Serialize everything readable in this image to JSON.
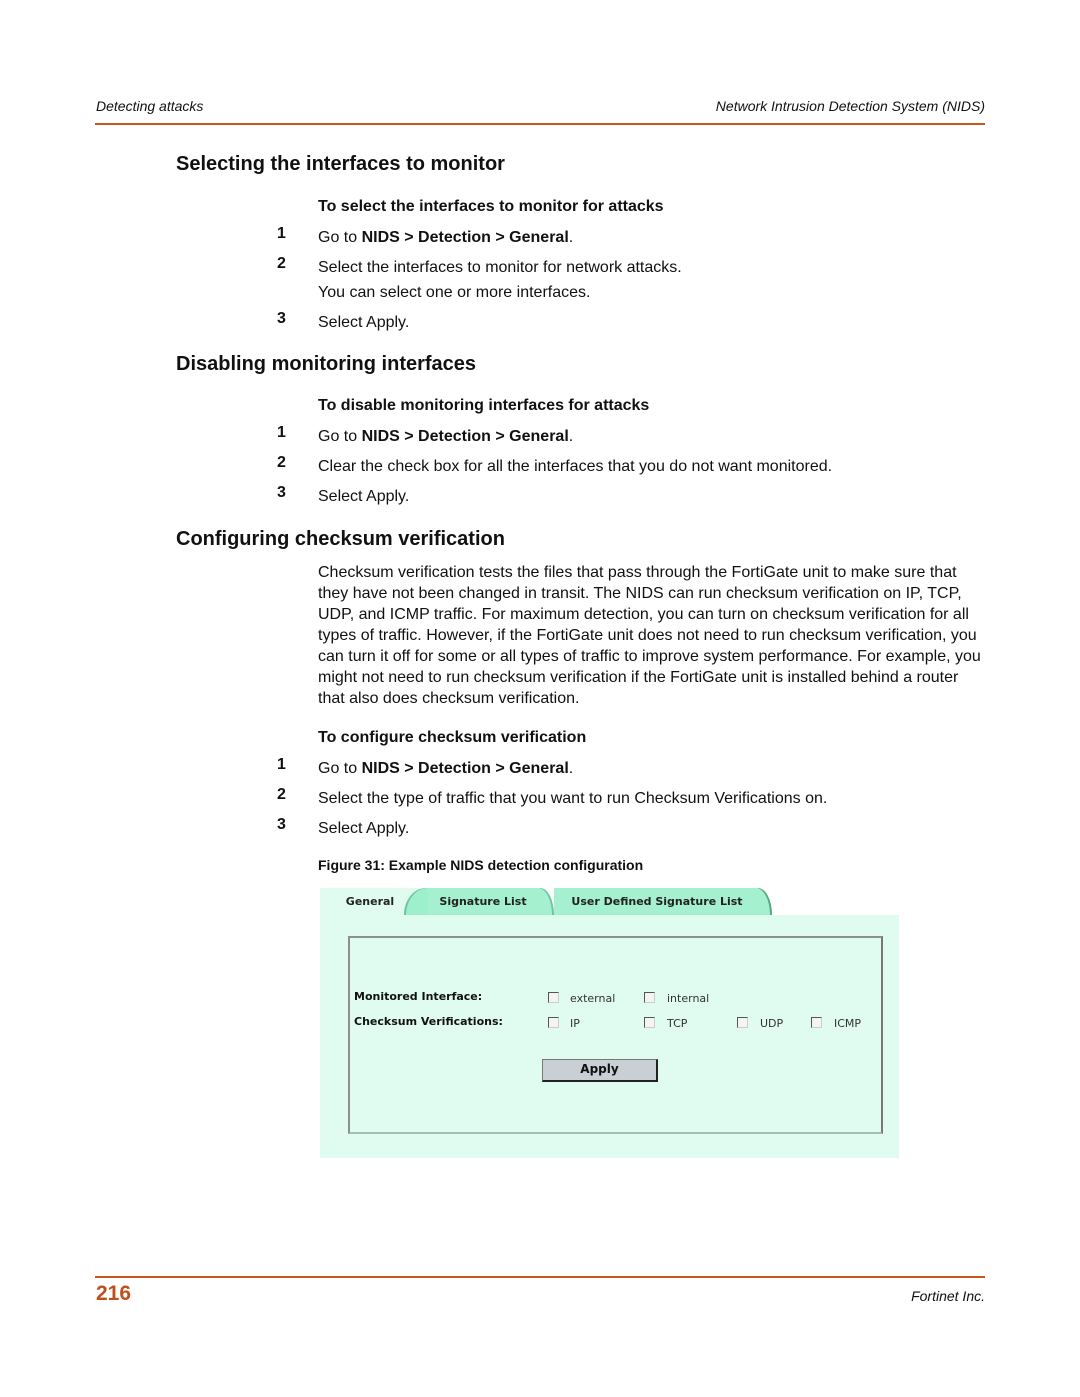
{
  "header": {
    "left": "Detecting attacks",
    "right": "Network Intrusion Detection System (NIDS)"
  },
  "sections": [
    {
      "title": "Selecting the interfaces to monitor",
      "procedure_title": "To select the interfaces to monitor for attacks",
      "steps": [
        {
          "num": "1",
          "prefix": "Go to ",
          "bold": "NIDS > Detection > General",
          "suffix": "."
        },
        {
          "num": "2",
          "text": "Select the interfaces to monitor for network attacks.",
          "text2": "You can select one or more interfaces."
        },
        {
          "num": "3",
          "text": "Select Apply."
        }
      ]
    },
    {
      "title": "Disabling monitoring interfaces",
      "procedure_title": "To disable monitoring interfaces for attacks",
      "steps": [
        {
          "num": "1",
          "prefix": "Go to ",
          "bold": "NIDS > Detection > General",
          "suffix": "."
        },
        {
          "num": "2",
          "text": "Clear the check box for all the interfaces that you do not want monitored."
        },
        {
          "num": "3",
          "text": "Select Apply."
        }
      ]
    },
    {
      "title": "Configuring checksum verification",
      "paragraph": "Checksum verification tests the files that pass through the FortiGate unit to make sure that they have not been changed in transit. The NIDS can run checksum verification on IP, TCP, UDP, and ICMP traffic. For maximum detection, you can turn on checksum verification for all types of traffic. However, if the FortiGate unit does not need to run checksum verification, you can turn it off for some or all types of traffic to improve system performance. For example, you might not need to run checksum verification if the FortiGate unit is installed behind a router that also does checksum verification.",
      "procedure_title": "To configure checksum verification",
      "steps": [
        {
          "num": "1",
          "prefix": "Go to ",
          "bold": "NIDS > Detection > General",
          "suffix": "."
        },
        {
          "num": "2",
          "text": "Select the type of traffic that you want to run Checksum Verifications on."
        },
        {
          "num": "3",
          "text": "Select Apply."
        }
      ]
    }
  ],
  "figure": {
    "caption": "Figure 31: Example NIDS detection configuration",
    "tabs": [
      {
        "label": "General",
        "active": true
      },
      {
        "label": "Signature List",
        "active": false
      },
      {
        "label": "User Defined Signature List",
        "active": false
      }
    ],
    "monitored_interface": {
      "label": "Monitored Interface:",
      "options": [
        {
          "label": "external",
          "checked": false
        },
        {
          "label": "internal",
          "checked": false
        }
      ]
    },
    "checksum_verifications": {
      "label": "Checksum Verifications:",
      "options": [
        {
          "label": "IP",
          "checked": false
        },
        {
          "label": "TCP",
          "checked": false
        },
        {
          "label": "UDP",
          "checked": false
        },
        {
          "label": "ICMP",
          "checked": false
        }
      ]
    },
    "apply_label": "Apply"
  },
  "footer": {
    "page_number": "216",
    "company": "Fortinet Inc."
  },
  "colors": {
    "accent_rule": "#c8571f",
    "page_number": "#c0501b",
    "panel_bg": "#e0fbef",
    "tab_bg": "#a5f1cf"
  }
}
